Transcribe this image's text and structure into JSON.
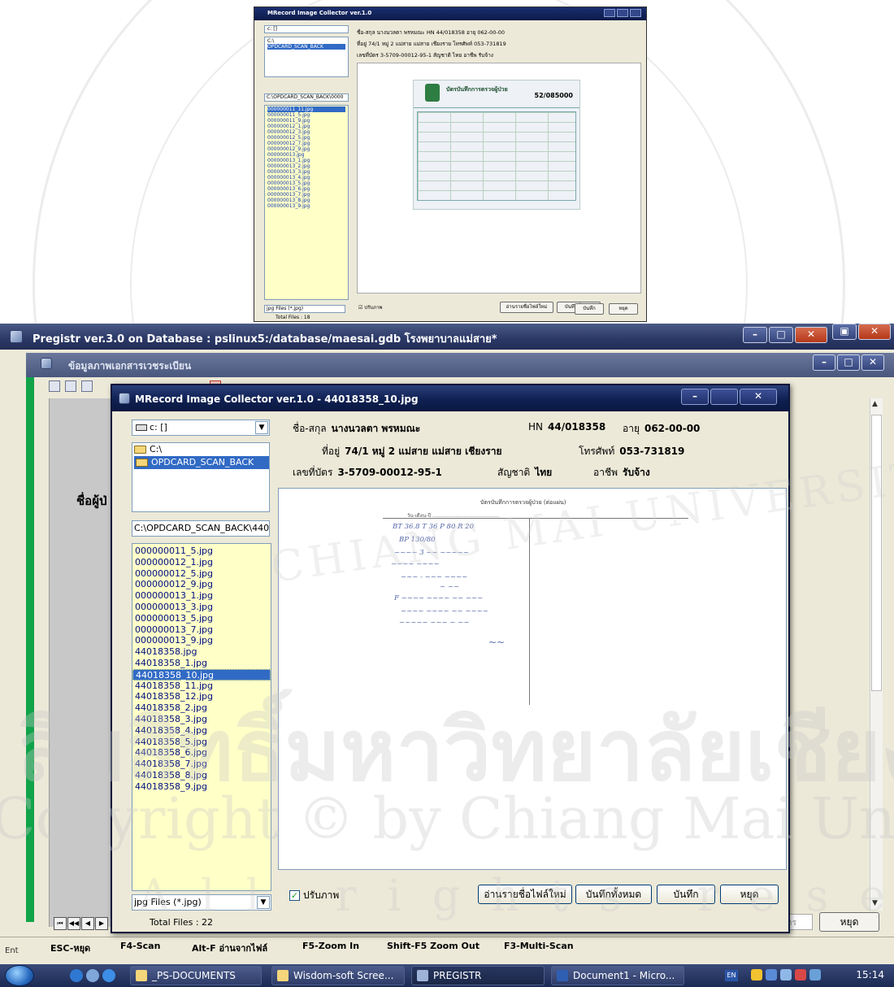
{
  "watermark": {
    "thai_line": "ลิขสิทธิ์มหาวิทยาลัยเชียงใหม่",
    "copyright_line": "Copyright © by Chiang Mai University",
    "rights_line": "All rights reserved",
    "arc_text": "CHIANG MAI UNIVERSITY"
  },
  "preview": {
    "title": "MRecord Image Collector ver.1.0",
    "drive": "c: []",
    "folders": [
      "C:\\",
      "OPDCARD_SCAN_BACK"
    ],
    "path": "C:\\OPDCARD_SCAN_BACK\\0000",
    "files": [
      "000000011_11.jpg",
      "000000011_5.jpg",
      "000000011_9.jpg",
      "000000012_1.jpg",
      "000000012_3.jpg",
      "000000012_5.jpg",
      "000000012_7.jpg",
      "000000012_9.jpg",
      "000000013.jpg",
      "000000013_1.jpg",
      "000000013_2.jpg",
      "000000013_3.jpg",
      "000000013_4.jpg",
      "000000013_5.jpg",
      "000000013_6.jpg",
      "000000013_7.jpg",
      "000000013_8.jpg",
      "000000013_9.jpg"
    ],
    "filter": "jpg Files (*.jpg)",
    "total": "Total Files : 18",
    "line1": "ชื่อ-สกุล  นางนวลตา พรหมณะ         HN  44/018358   อายุ  062-00-00",
    "line2": "ที่อยู่  74/1 หมู่ 2 แม่สาย  แม่สาย  เชียงราย          โทรศัพท์  053-731819",
    "line3": "เลขที่บัตร  3-5709-00012-95-1         สัญชาติ  ไทย         อาชีพ  รับจ้าง",
    "card_title": "บัตรบันทึกการตรวจผู้ป่วย",
    "card_number": "52/085000",
    "adjust": "ปรับภาพ",
    "btn_read": "อ่านรายชื่อไฟล์ใหม่",
    "btn_save_all": "บันทึกทั้งหมด",
    "btn_save": "บันทึก",
    "btn_stop": "หยุด"
  },
  "registr": {
    "title": "Pregistr ver.3.0 on  Database : pslinux5:/database/maesai.gdb  โรงพยาบาลแม่สาย*",
    "subtitle": "ข้อมูลภาพเอกสารเวชระเบียน",
    "side_label": "ชื่อผู้ป่",
    "stop_label": "หยุด",
    "small_box": "าร"
  },
  "fkeys": [
    {
      "label": "ESC-หยุด"
    },
    {
      "label": "F4-Scan"
    },
    {
      "label": "Alt-F อ่านจากไฟล์"
    },
    {
      "label": "F5-Zoom In"
    },
    {
      "label": "Shift-F5 Zoom Out"
    },
    {
      "label": "F3-Multi-Scan"
    }
  ],
  "fkbar_left": "Ent",
  "dialog": {
    "title": "MRecord Image Collector ver.1.0 - 44018358_10.jpg",
    "drive": "c: []",
    "folders": [
      "C:\\",
      "OPDCARD_SCAN_BACK"
    ],
    "path": "C:\\OPDCARD_SCAN_BACK\\4401",
    "files": [
      "000000011_5.jpg",
      "000000012_1.jpg",
      "000000012_5.jpg",
      "000000012_9.jpg",
      "000000013_1.jpg",
      "000000013_3.jpg",
      "000000013_5.jpg",
      "000000013_7.jpg",
      "000000013_9.jpg",
      "44018358.jpg",
      "44018358_1.jpg",
      "44018358_10.jpg",
      "44018358_11.jpg",
      "44018358_12.jpg",
      "44018358_2.jpg",
      "44018358_3.jpg",
      "44018358_4.jpg",
      "44018358_5.jpg",
      "44018358_6.jpg",
      "44018358_7.jpg",
      "44018358_8.jpg",
      "44018358_9.jpg"
    ],
    "selected_file": "44018358_10.jpg",
    "filter": "jpg Files (*.jpg)",
    "total": "Total Files : 22",
    "name_label": "ชื่อ-สกุล",
    "name_value": "นางนวลตา พรหมณะ",
    "hn_label": "HN",
    "hn_value": "44/018358",
    "age_label": "อายุ",
    "age_value": "062-00-00",
    "address_label": "ที่อยู่",
    "address_value": "74/1 หมู่ 2 แม่สาย  แม่สาย  เชียงราย",
    "phone_label": "โทรศัพท์",
    "phone_value": "053-731819",
    "id_label": "เลขที่บัตร",
    "id_value": "3-5709-00012-95-1",
    "nation_label": "สัญชาติ",
    "nation_value": "ไทย",
    "job_label": "อาชีพ",
    "job_value": "รับจ้าง",
    "scan_header": "บัตรบันทึกการตรวจผู้ป่วย (ต่อแผ่น)",
    "scan_sub": "วัน-เดือน-ปี ...........................................",
    "adjust": "ปรับภาพ",
    "btn_read": "อ่านรายชื่อไฟล์ใหม่",
    "btn_save_all": "บันทึกทั้งหมด",
    "btn_save": "บันทึก",
    "btn_stop": "หยุด"
  },
  "taskbar": {
    "tasks": [
      "_PS-DOCUMENTS",
      "Wisdom-soft Scree...",
      "PREGISTR",
      "Document1 - Micro..."
    ],
    "lang": "EN",
    "clock": "15:14"
  }
}
